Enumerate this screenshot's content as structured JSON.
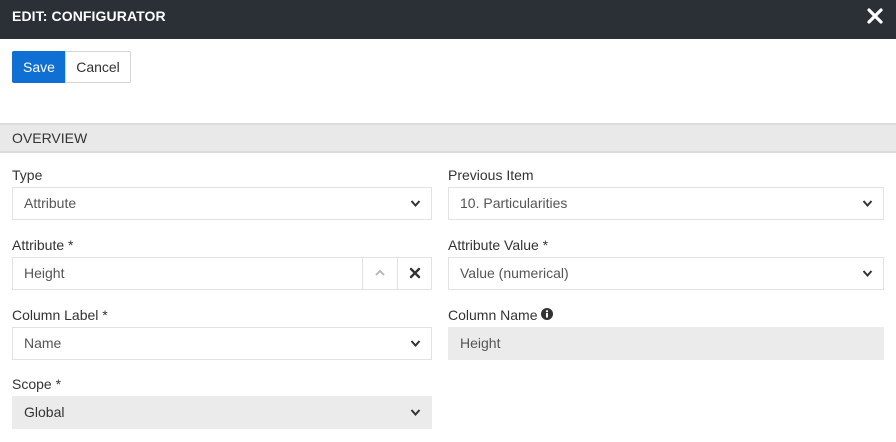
{
  "window": {
    "title": "EDIT: CONFIGURATOR",
    "close_icon": "close-icon"
  },
  "toolbar": {
    "save_label": "Save",
    "cancel_label": "Cancel",
    "accent": "#0f6fd2"
  },
  "section": {
    "title": "OVERVIEW"
  },
  "form": {
    "type": {
      "label": "Type",
      "value": "Attribute"
    },
    "previous_item": {
      "label": "Previous Item",
      "value": "10. Particularities"
    },
    "attribute": {
      "label": "Attribute *",
      "value": "Height"
    },
    "attribute_value": {
      "label": "Attribute Value *",
      "value": "Value (numerical)"
    },
    "column_label": {
      "label": "Column Label *",
      "value": "Name"
    },
    "column_name": {
      "label": "Column Name",
      "value": "Height",
      "info_icon": "info-icon"
    },
    "scope": {
      "label": "Scope *",
      "value": "Global"
    }
  }
}
